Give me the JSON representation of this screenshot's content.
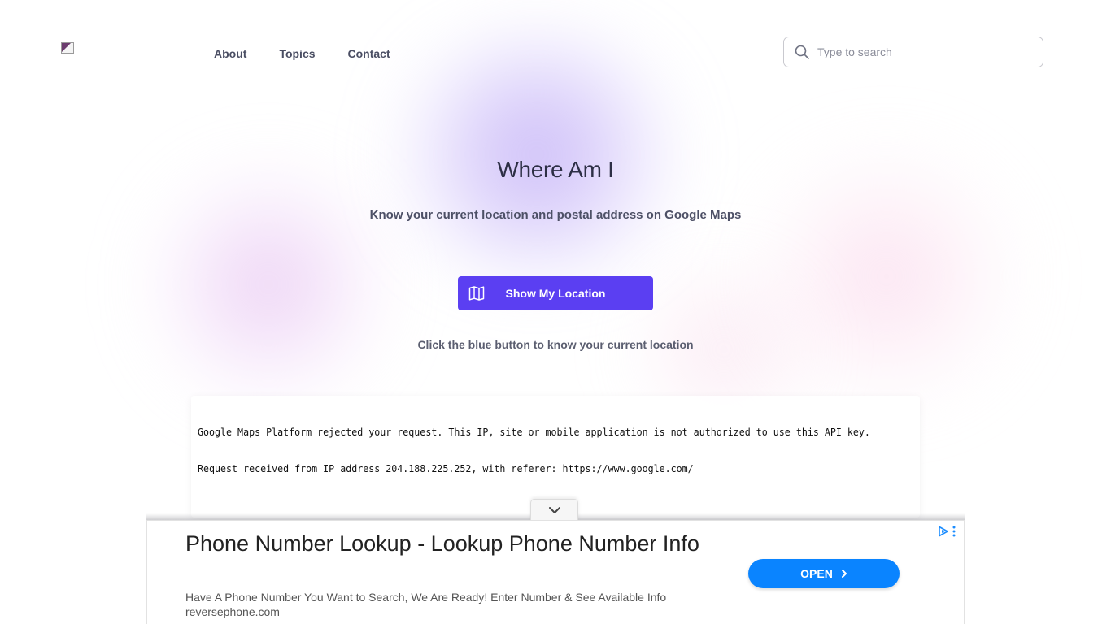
{
  "header": {
    "nav": [
      "About",
      "Topics",
      "Contact"
    ],
    "search_placeholder": "Type to search"
  },
  "hero": {
    "title": "Where Am I",
    "subtitle": "Know your current location and postal address on Google Maps",
    "button_label": "Show My Location",
    "hint": "Click the blue button to know your current location"
  },
  "map": {
    "error_line1": "Google Maps Platform rejected your request. This IP, site or mobile application is not authorized to use this API key.",
    "error_line2": "Request received from IP address 204.188.225.252, with referer: https://www.google.com/"
  },
  "ad": {
    "title": "Phone Number Lookup - Lookup Phone Number Info",
    "description": "Have A Phone Number You Want to Search, We Are Ready! Enter Number & See Available Info",
    "url": "reversephone.com",
    "open_label": "OPEN"
  },
  "colors": {
    "primary_button": "#5b3ff2",
    "ad_button": "#0a84ff",
    "heading": "#2d2f45"
  },
  "icons": [
    "broken-image-icon",
    "search-icon",
    "map-icon",
    "chevron-down-icon",
    "chevron-right-icon",
    "adchoices-icon",
    "ad-menu-icon"
  ]
}
